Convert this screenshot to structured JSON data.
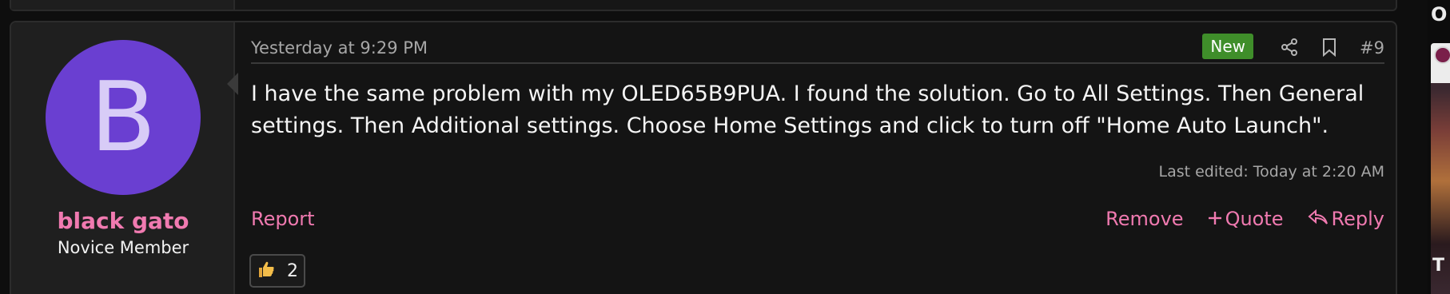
{
  "post": {
    "author": {
      "avatar_letter": "B",
      "username": "black gato",
      "title": "Novice Member"
    },
    "timestamp": "Yesterday at 9:29 PM",
    "badge_new": "New",
    "post_number": "#9",
    "body": "I have the same problem with my OLED65B9PUA. I found the solution. Go to All Settings. Then General settings. Then Additional settings. Choose Home Settings and click to turn off \"Home Auto Launch\".",
    "last_edited": "Last edited: Today at 2:20 AM",
    "actions": {
      "report": "Report",
      "remove": "Remove",
      "quote": "Quote",
      "reply": "Reply"
    },
    "reaction": {
      "icon": "thumbs-up-icon",
      "count": "2"
    }
  },
  "sidebar": {
    "heading_fragment": "O",
    "thumb_letter": "T"
  },
  "colors": {
    "accent": "#f07ab0",
    "avatar_bg": "#6a3fd1",
    "new_badge": "#3f8e2a",
    "background": "#141414"
  }
}
